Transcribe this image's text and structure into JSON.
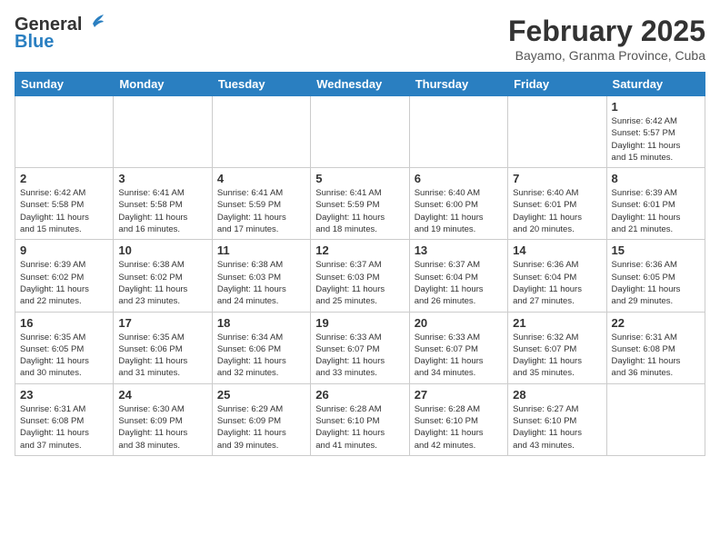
{
  "header": {
    "logo_general": "General",
    "logo_blue": "Blue",
    "title": "February 2025",
    "location": "Bayamo, Granma Province, Cuba"
  },
  "days_of_week": [
    "Sunday",
    "Monday",
    "Tuesday",
    "Wednesday",
    "Thursday",
    "Friday",
    "Saturday"
  ],
  "weeks": [
    [
      {
        "day": "",
        "info": ""
      },
      {
        "day": "",
        "info": ""
      },
      {
        "day": "",
        "info": ""
      },
      {
        "day": "",
        "info": ""
      },
      {
        "day": "",
        "info": ""
      },
      {
        "day": "",
        "info": ""
      },
      {
        "day": "1",
        "info": "Sunrise: 6:42 AM\nSunset: 5:57 PM\nDaylight: 11 hours\nand 15 minutes."
      }
    ],
    [
      {
        "day": "2",
        "info": "Sunrise: 6:42 AM\nSunset: 5:58 PM\nDaylight: 11 hours\nand 15 minutes."
      },
      {
        "day": "3",
        "info": "Sunrise: 6:41 AM\nSunset: 5:58 PM\nDaylight: 11 hours\nand 16 minutes."
      },
      {
        "day": "4",
        "info": "Sunrise: 6:41 AM\nSunset: 5:59 PM\nDaylight: 11 hours\nand 17 minutes."
      },
      {
        "day": "5",
        "info": "Sunrise: 6:41 AM\nSunset: 5:59 PM\nDaylight: 11 hours\nand 18 minutes."
      },
      {
        "day": "6",
        "info": "Sunrise: 6:40 AM\nSunset: 6:00 PM\nDaylight: 11 hours\nand 19 minutes."
      },
      {
        "day": "7",
        "info": "Sunrise: 6:40 AM\nSunset: 6:01 PM\nDaylight: 11 hours\nand 20 minutes."
      },
      {
        "day": "8",
        "info": "Sunrise: 6:39 AM\nSunset: 6:01 PM\nDaylight: 11 hours\nand 21 minutes."
      }
    ],
    [
      {
        "day": "9",
        "info": "Sunrise: 6:39 AM\nSunset: 6:02 PM\nDaylight: 11 hours\nand 22 minutes."
      },
      {
        "day": "10",
        "info": "Sunrise: 6:38 AM\nSunset: 6:02 PM\nDaylight: 11 hours\nand 23 minutes."
      },
      {
        "day": "11",
        "info": "Sunrise: 6:38 AM\nSunset: 6:03 PM\nDaylight: 11 hours\nand 24 minutes."
      },
      {
        "day": "12",
        "info": "Sunrise: 6:37 AM\nSunset: 6:03 PM\nDaylight: 11 hours\nand 25 minutes."
      },
      {
        "day": "13",
        "info": "Sunrise: 6:37 AM\nSunset: 6:04 PM\nDaylight: 11 hours\nand 26 minutes."
      },
      {
        "day": "14",
        "info": "Sunrise: 6:36 AM\nSunset: 6:04 PM\nDaylight: 11 hours\nand 27 minutes."
      },
      {
        "day": "15",
        "info": "Sunrise: 6:36 AM\nSunset: 6:05 PM\nDaylight: 11 hours\nand 29 minutes."
      }
    ],
    [
      {
        "day": "16",
        "info": "Sunrise: 6:35 AM\nSunset: 6:05 PM\nDaylight: 11 hours\nand 30 minutes."
      },
      {
        "day": "17",
        "info": "Sunrise: 6:35 AM\nSunset: 6:06 PM\nDaylight: 11 hours\nand 31 minutes."
      },
      {
        "day": "18",
        "info": "Sunrise: 6:34 AM\nSunset: 6:06 PM\nDaylight: 11 hours\nand 32 minutes."
      },
      {
        "day": "19",
        "info": "Sunrise: 6:33 AM\nSunset: 6:07 PM\nDaylight: 11 hours\nand 33 minutes."
      },
      {
        "day": "20",
        "info": "Sunrise: 6:33 AM\nSunset: 6:07 PM\nDaylight: 11 hours\nand 34 minutes."
      },
      {
        "day": "21",
        "info": "Sunrise: 6:32 AM\nSunset: 6:07 PM\nDaylight: 11 hours\nand 35 minutes."
      },
      {
        "day": "22",
        "info": "Sunrise: 6:31 AM\nSunset: 6:08 PM\nDaylight: 11 hours\nand 36 minutes."
      }
    ],
    [
      {
        "day": "23",
        "info": "Sunrise: 6:31 AM\nSunset: 6:08 PM\nDaylight: 11 hours\nand 37 minutes."
      },
      {
        "day": "24",
        "info": "Sunrise: 6:30 AM\nSunset: 6:09 PM\nDaylight: 11 hours\nand 38 minutes."
      },
      {
        "day": "25",
        "info": "Sunrise: 6:29 AM\nSunset: 6:09 PM\nDaylight: 11 hours\nand 39 minutes."
      },
      {
        "day": "26",
        "info": "Sunrise: 6:28 AM\nSunset: 6:10 PM\nDaylight: 11 hours\nand 41 minutes."
      },
      {
        "day": "27",
        "info": "Sunrise: 6:28 AM\nSunset: 6:10 PM\nDaylight: 11 hours\nand 42 minutes."
      },
      {
        "day": "28",
        "info": "Sunrise: 6:27 AM\nSunset: 6:10 PM\nDaylight: 11 hours\nand 43 minutes."
      },
      {
        "day": "",
        "info": ""
      }
    ]
  ]
}
